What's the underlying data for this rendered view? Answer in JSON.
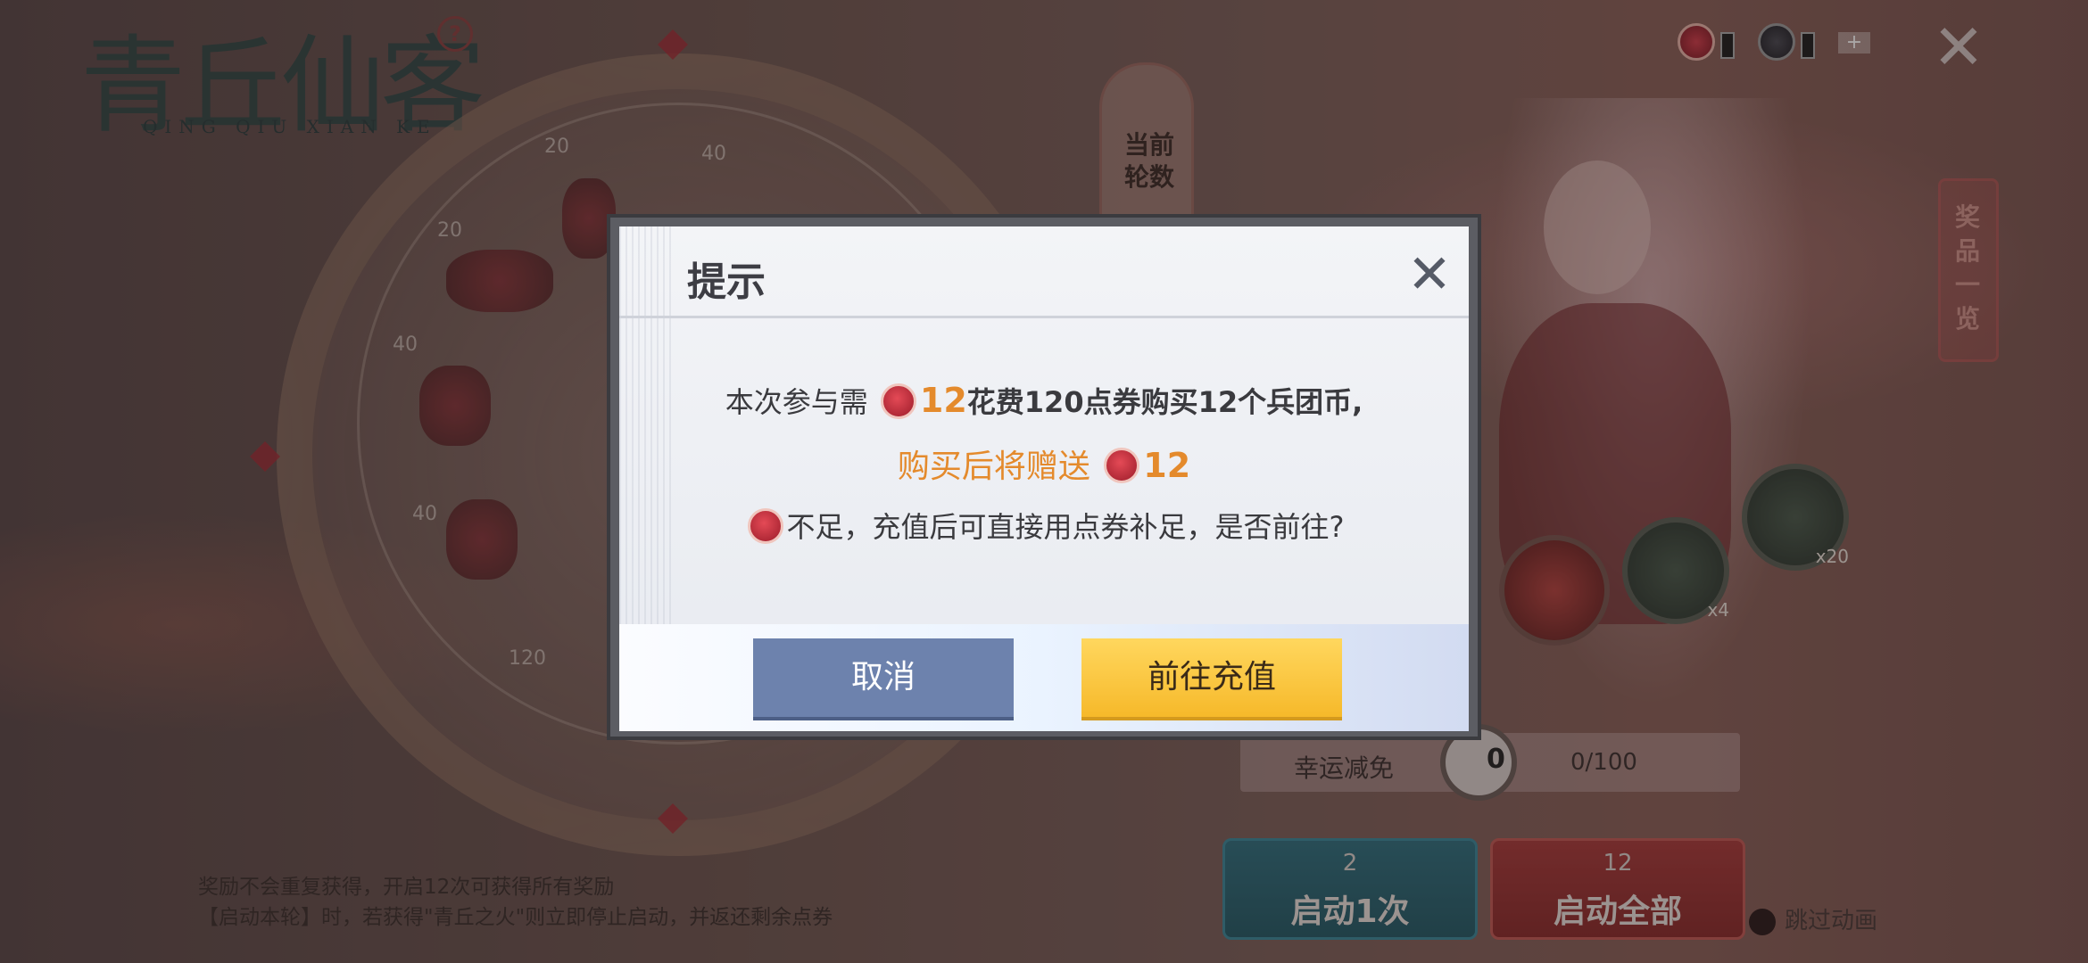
{
  "background": {
    "logo": {
      "title": "青丘仙客",
      "pinyin": "QING QIU XIAN KE"
    },
    "help_icon": "question-icon",
    "wheel_labels": [
      "20",
      "40",
      "20",
      "40",
      "40",
      "120"
    ],
    "round_label": "当前轮数",
    "showcase_label": "奖品一览",
    "ring_counts": [
      "x20",
      "x4"
    ],
    "lucky": {
      "label": "幸运减免",
      "mid_value": "0",
      "progress": "0/100"
    },
    "start_one": {
      "cost": "2",
      "label": "启动1次"
    },
    "start_all": {
      "cost": "12",
      "label": "启动全部"
    },
    "skip_label": "跳过动画",
    "notes": [
      "奖励不会重复获得，开启12次可获得所有奖励",
      "【启动本轮】时，若获得\"青丘之火\"则立即停止启动，并返还剩余点券"
    ]
  },
  "dialog": {
    "title": "提示",
    "line1": {
      "prefix": "本次参与需",
      "coin_count": "12",
      "suffix": "花费120点券购买12个兵团币,"
    },
    "line2": {
      "text": "购买后将赠送",
      "coin_count": "12"
    },
    "line3": {
      "text": "不足，充值后可直接用点券补足，是否前往?"
    },
    "cancel_label": "取消",
    "confirm_label": "前往充值"
  },
  "colors": {
    "accent_orange": "#e48a2c",
    "cancel_button": "#6d82ad",
    "confirm_button": "#f6b92a",
    "coin_red": "#c92c3b"
  }
}
